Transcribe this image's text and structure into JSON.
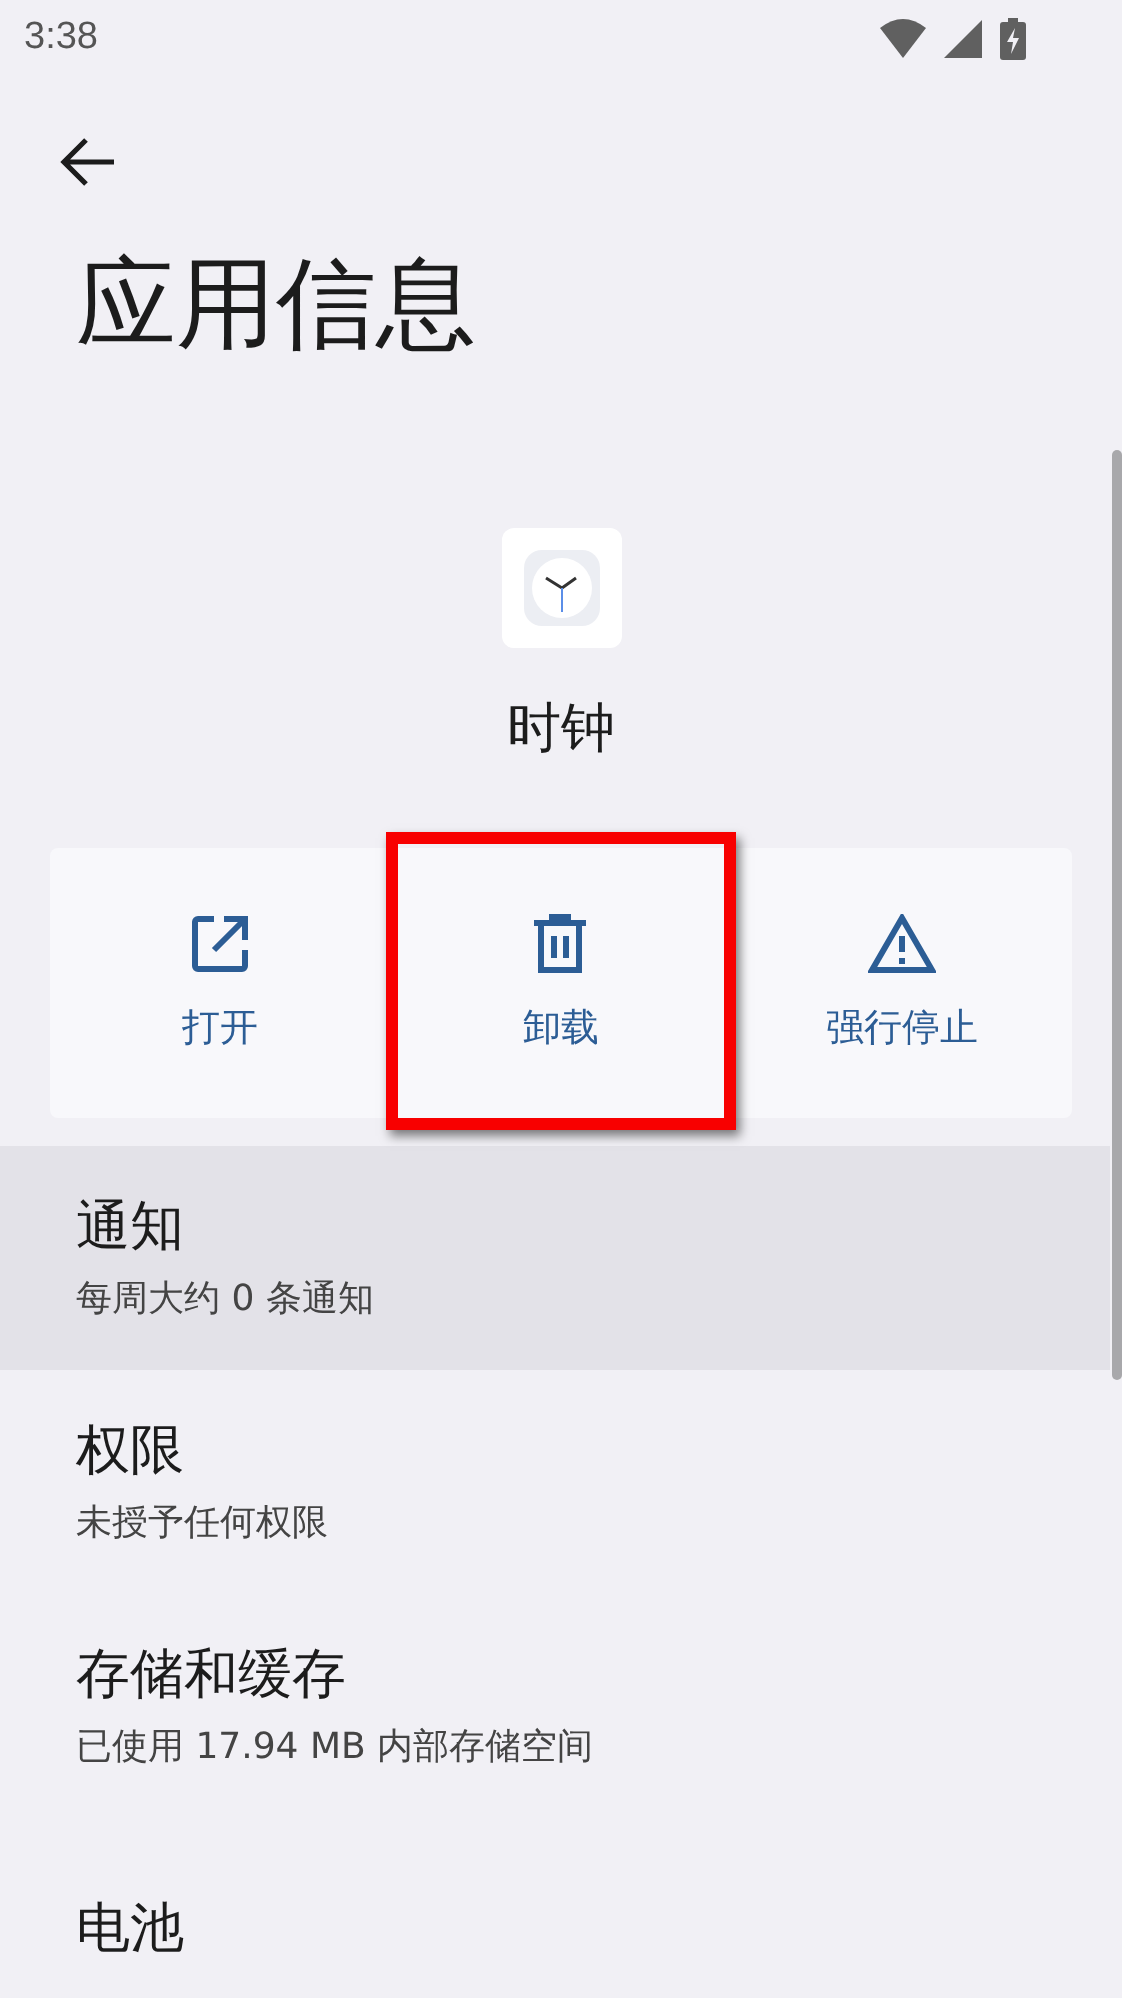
{
  "status_bar": {
    "time": "3:38"
  },
  "title": "应用信息",
  "app": {
    "name": "时钟"
  },
  "actions": [
    {
      "kind": "open",
      "label": "打开",
      "highlighted": false
    },
    {
      "kind": "uninstall",
      "label": "卸载",
      "highlighted": true
    },
    {
      "kind": "stop",
      "label": "强行停止",
      "highlighted": false
    }
  ],
  "settings": [
    {
      "title": "通知",
      "summary": "每周大约 0 条通知",
      "selected": true
    },
    {
      "title": "权限",
      "summary": "未授予任何权限",
      "selected": false
    },
    {
      "title": "存储和缓存",
      "summary": "已使用 17.94 MB 内部存储空间",
      "selected": false
    },
    {
      "title": "电池",
      "selected": false
    }
  ]
}
